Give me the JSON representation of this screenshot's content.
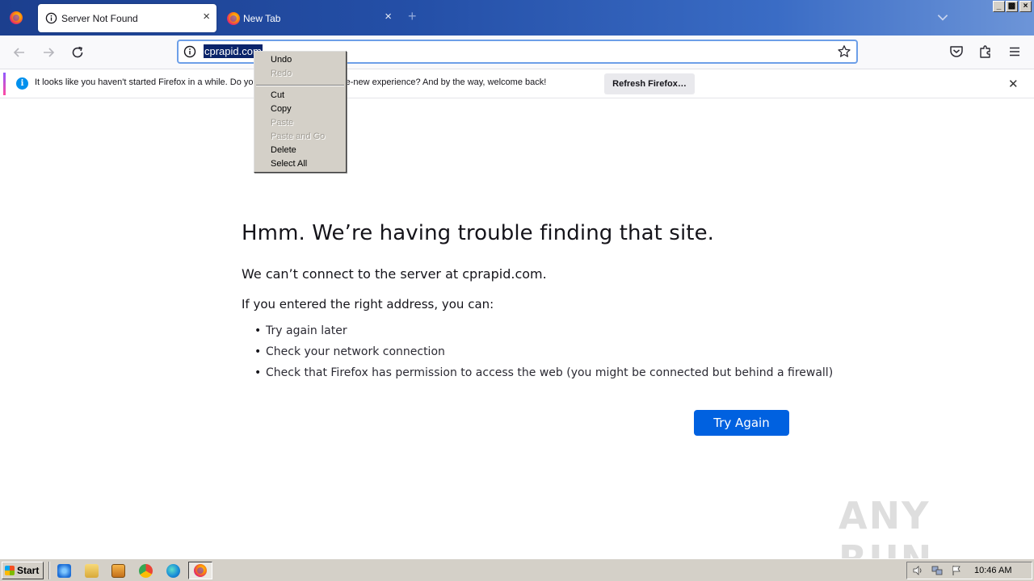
{
  "browser": {
    "tabs": [
      {
        "title": "Server Not Found",
        "active": true
      },
      {
        "title": "New Tab",
        "active": false
      }
    ],
    "url": "cprapid.com",
    "window_controls": [
      "_",
      "▫",
      "×"
    ]
  },
  "notification": {
    "text": "It looks like you haven't started Firefox in a while. Do yo",
    "text_tail": "a fresh, like-new experience? And by the way, welcome back!",
    "button_label": "Refresh Firefox…"
  },
  "error_page": {
    "title": "Hmm. We’re having trouble finding that site.",
    "description": "We can’t connect to the server at cprapid.com.",
    "subheading": "If you entered the right address, you can:",
    "suggestions": [
      "Try again later",
      "Check your network connection",
      "Check that Firefox has permission to access the web (you might be connected but behind a firewall)"
    ],
    "button_label": "Try Again"
  },
  "context_menu": {
    "items": [
      {
        "label": "Undo",
        "enabled": true
      },
      {
        "label": "Redo",
        "enabled": false
      },
      {
        "label": "Cut",
        "enabled": true
      },
      {
        "label": "Copy",
        "enabled": true
      },
      {
        "label": "Paste",
        "enabled": false
      },
      {
        "label": "Paste and Go",
        "enabled": false
      },
      {
        "label": "Delete",
        "enabled": true
      },
      {
        "label": "Select All",
        "enabled": true
      }
    ]
  },
  "watermark": "ANY RUN",
  "taskbar": {
    "start_label": "Start",
    "clock": "10:46 AM",
    "quicklaunch": [
      "ie-icon",
      "explorer-icon",
      "media-player-icon",
      "chrome-icon",
      "edge-icon"
    ],
    "running": [
      "firefox-icon"
    ]
  },
  "colors": {
    "primary_button": "#0061e0",
    "url_selection": "#0a246a",
    "info_blue": "#0090ed"
  }
}
